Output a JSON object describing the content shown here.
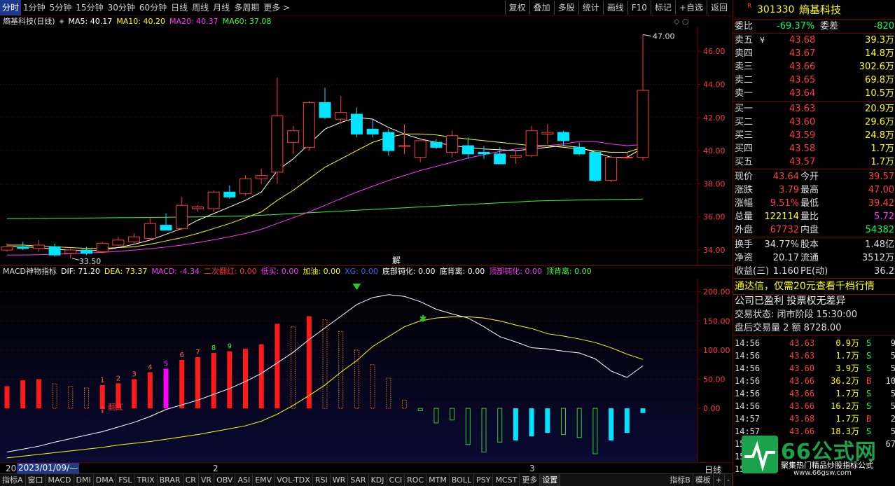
{
  "toolbar": {
    "periods": [
      "分时",
      "1分钟",
      "5分钟",
      "15分钟",
      "30分钟",
      "60分钟",
      "日线",
      "周线",
      "月线",
      "多周期",
      "更多 >"
    ],
    "active_period": "分时",
    "right_buttons": [
      "复权",
      "叠加",
      "多股",
      "统计",
      "画线",
      "F10",
      "标记",
      "+自选",
      "返回"
    ]
  },
  "chart_header": {
    "name": "熵基科技(日线)",
    "ma5": "MA5: 40.17",
    "ma10": "MA10: 40.20",
    "ma20": "MA20: 40.37",
    "ma60": "MA60: 37.08",
    "high_marker": "47.00",
    "low_marker": "33.50",
    "jie_label": "解"
  },
  "macd_header": {
    "name": "MACD神物指标",
    "items": [
      {
        "label": "DIF: 71.20",
        "color": "#ffffff"
      },
      {
        "label": "DEA: 73.37",
        "color": "#ffff00"
      },
      {
        "label": "MACD: -4.34",
        "color": "#ff33ff"
      },
      {
        "label": "二次翻红: 0.00",
        "color": "#ff3333"
      },
      {
        "label": "低买: 0.00",
        "color": "#ff33ff"
      },
      {
        "label": "加油: 0.00",
        "color": "#ffff00"
      },
      {
        "label": "XG: 0.00",
        "color": "#3366ff"
      },
      {
        "label": "底部钝化: 0.00",
        "color": "#ffffff"
      },
      {
        "label": "底背离: 0.00",
        "color": "#ffffff"
      },
      {
        "label": "顶部钝化: 0.00",
        "color": "#ff33ff"
      },
      {
        "label": "顶背离: 0.00",
        "color": "#33ff33"
      }
    ],
    "fanhong": "翻红"
  },
  "chart_data": [
    {
      "type": "candlestick",
      "title": "熵基科技(日线)",
      "ylim": [
        33.2,
        47.4
      ],
      "yticks": [
        34.0,
        36.0,
        38.0,
        40.0,
        42.0,
        44.0,
        46.0
      ],
      "colors": {
        "up": "#ff3b3b",
        "down": "#00e5ff",
        "ma5": "#ffffff",
        "ma10": "#ffff00",
        "ma20": "#ff33ff",
        "ma60": "#33ff33"
      },
      "candles": [
        {
          "o": 34.0,
          "h": 34.4,
          "l": 33.9,
          "c": 34.2
        },
        {
          "o": 34.2,
          "h": 34.5,
          "l": 34.0,
          "c": 34.1
        },
        {
          "o": 34.1,
          "h": 34.6,
          "l": 33.9,
          "c": 34.3
        },
        {
          "o": 34.2,
          "h": 34.4,
          "l": 33.6,
          "c": 33.7
        },
        {
          "o": 33.8,
          "h": 34.1,
          "l": 33.5,
          "c": 34.0
        },
        {
          "o": 34.0,
          "h": 34.2,
          "l": 33.7,
          "c": 33.8
        },
        {
          "o": 33.9,
          "h": 34.5,
          "l": 33.8,
          "c": 34.4
        },
        {
          "o": 34.3,
          "h": 34.8,
          "l": 34.2,
          "c": 34.6
        },
        {
          "o": 34.5,
          "h": 35.0,
          "l": 34.4,
          "c": 34.8
        },
        {
          "o": 34.7,
          "h": 36.0,
          "l": 34.6,
          "c": 35.6
        },
        {
          "o": 35.5,
          "h": 36.2,
          "l": 35.2,
          "c": 35.2
        },
        {
          "o": 35.3,
          "h": 37.2,
          "l": 35.2,
          "c": 36.7
        },
        {
          "o": 36.5,
          "h": 36.7,
          "l": 36.3,
          "c": 36.6
        },
        {
          "o": 36.5,
          "h": 37.6,
          "l": 36.3,
          "c": 37.5
        },
        {
          "o": 37.5,
          "h": 37.9,
          "l": 37.1,
          "c": 37.2
        },
        {
          "o": 37.4,
          "h": 38.5,
          "l": 37.3,
          "c": 38.3
        },
        {
          "o": 38.3,
          "h": 38.9,
          "l": 38.0,
          "c": 38.5
        },
        {
          "o": 38.7,
          "h": 44.4,
          "l": 38.0,
          "c": 42.1
        },
        {
          "o": 40.5,
          "h": 41.5,
          "l": 39.8,
          "c": 41.2
        },
        {
          "o": 40.2,
          "h": 43.0,
          "l": 40.0,
          "c": 42.9
        },
        {
          "o": 42.9,
          "h": 43.8,
          "l": 41.9,
          "c": 42.0
        },
        {
          "o": 41.9,
          "h": 43.3,
          "l": 41.6,
          "c": 42.3
        },
        {
          "o": 42.2,
          "h": 42.6,
          "l": 40.8,
          "c": 41.0
        },
        {
          "o": 41.3,
          "h": 41.9,
          "l": 40.8,
          "c": 41.0
        },
        {
          "o": 41.1,
          "h": 41.3,
          "l": 39.7,
          "c": 40.0
        },
        {
          "o": 40.3,
          "h": 41.6,
          "l": 39.8,
          "c": 40.3
        },
        {
          "o": 39.6,
          "h": 40.6,
          "l": 39.3,
          "c": 40.6
        },
        {
          "o": 40.5,
          "h": 40.7,
          "l": 40.1,
          "c": 40.2
        },
        {
          "o": 39.9,
          "h": 41.2,
          "l": 39.6,
          "c": 40.9
        },
        {
          "o": 40.3,
          "h": 40.8,
          "l": 39.5,
          "c": 39.8
        },
        {
          "o": 39.9,
          "h": 40.3,
          "l": 39.5,
          "c": 39.8
        },
        {
          "o": 39.8,
          "h": 40.2,
          "l": 39.2,
          "c": 39.2
        },
        {
          "o": 39.6,
          "h": 40.0,
          "l": 39.2,
          "c": 39.7
        },
        {
          "o": 39.7,
          "h": 41.5,
          "l": 39.6,
          "c": 41.2
        },
        {
          "o": 41.0,
          "h": 41.6,
          "l": 40.4,
          "c": 41.1
        },
        {
          "o": 41.1,
          "h": 41.2,
          "l": 40.3,
          "c": 40.6
        },
        {
          "o": 40.2,
          "h": 40.5,
          "l": 39.7,
          "c": 39.8
        },
        {
          "o": 39.9,
          "h": 40.0,
          "l": 38.1,
          "c": 38.2
        },
        {
          "o": 38.2,
          "h": 39.7,
          "l": 38.1,
          "c": 39.6
        },
        {
          "o": 39.6,
          "h": 39.9,
          "l": 39.5,
          "c": 39.6
        },
        {
          "o": 39.6,
          "h": 47.0,
          "l": 39.4,
          "c": 43.64
        }
      ],
      "ma5": [
        34.2,
        34.2,
        34.15,
        34.05,
        34.0,
        33.95,
        34.0,
        34.15,
        34.35,
        34.6,
        34.95,
        35.3,
        35.8,
        36.2,
        36.6,
        37.0,
        37.5,
        38.8,
        39.5,
        40.4,
        41.3,
        41.7,
        42.0,
        41.9,
        41.4,
        41.0,
        40.7,
        40.5,
        40.3,
        40.2,
        40.1,
        40.05,
        40.0,
        40.1,
        40.2,
        40.3,
        40.2,
        39.9,
        39.6,
        39.6,
        40.17
      ],
      "ma10": [
        34.3,
        34.3,
        34.25,
        34.2,
        34.15,
        34.1,
        34.1,
        34.15,
        34.2,
        34.35,
        34.55,
        34.75,
        35.0,
        35.3,
        35.6,
        35.95,
        36.3,
        37.0,
        37.6,
        38.3,
        39.0,
        39.5,
        40.0,
        40.5,
        40.8,
        41.0,
        41.0,
        40.95,
        40.8,
        40.7,
        40.6,
        40.5,
        40.4,
        40.3,
        40.3,
        40.2,
        40.1,
        40.0,
        39.9,
        39.9,
        40.2
      ],
      "ma20": [
        33.7,
        33.7,
        33.72,
        33.75,
        33.78,
        33.82,
        33.86,
        33.92,
        34.0,
        34.08,
        34.18,
        34.3,
        34.45,
        34.62,
        34.8,
        35.0,
        35.25,
        35.6,
        35.95,
        36.3,
        36.7,
        37.1,
        37.5,
        37.85,
        38.2,
        38.5,
        38.8,
        39.05,
        39.3,
        39.55,
        39.75,
        39.95,
        40.1,
        40.2,
        40.3,
        40.4,
        40.55,
        40.55,
        40.4,
        40.3,
        40.37
      ],
      "ma60": [
        35.9,
        35.9,
        35.91,
        35.92,
        35.92,
        35.93,
        35.94,
        35.95,
        35.96,
        35.97,
        35.98,
        35.99,
        36.0,
        36.02,
        36.04,
        36.06,
        36.1,
        36.15,
        36.2,
        36.25,
        36.3,
        36.35,
        36.4,
        36.45,
        36.5,
        36.55,
        36.6,
        36.65,
        36.7,
        36.75,
        36.8,
        36.85,
        36.9,
        36.95,
        36.98,
        37.0,
        37.02,
        37.03,
        37.05,
        37.06,
        37.08
      ]
    },
    {
      "type": "bar",
      "title": "MACD神物指标",
      "ylim": [
        -90,
        220
      ],
      "yticks": [
        0.0,
        50.0,
        100.0,
        150.0,
        200.0
      ],
      "colors": {
        "red": "#ff1a1a",
        "magenta": "#ff00ff",
        "cyan": "#00e5ff",
        "green": "#33cc33",
        "orange": "#e07010",
        "dif": "#ffffff",
        "dea": "#ffff00"
      },
      "bars": [
        {
          "v": 38,
          "c": "red",
          "f": "solid"
        },
        {
          "v": 48,
          "c": "red",
          "f": "solid"
        },
        {
          "v": 50,
          "c": "red",
          "f": "solid"
        },
        {
          "v": 42,
          "c": "orange",
          "f": "hollow"
        },
        {
          "v": 38,
          "c": "orange",
          "f": "hollow"
        },
        {
          "v": 35,
          "c": "orange",
          "f": "hollow"
        },
        {
          "v": 40,
          "c": "red",
          "f": "solid",
          "label": "1"
        },
        {
          "v": 43,
          "c": "red",
          "f": "solid",
          "label": "2"
        },
        {
          "v": 50,
          "c": "red",
          "f": "solid",
          "label": "3"
        },
        {
          "v": 62,
          "c": "red",
          "f": "solid",
          "label": "4"
        },
        {
          "v": 68,
          "c": "magenta",
          "f": "solid",
          "label": "5"
        },
        {
          "v": 83,
          "c": "red",
          "f": "solid",
          "label": "6"
        },
        {
          "v": 88,
          "c": "red",
          "f": "solid",
          "label": "7"
        },
        {
          "v": 95,
          "c": "red",
          "f": "solid",
          "label": "8"
        },
        {
          "v": 98,
          "c": "red",
          "f": "solid",
          "label": "9"
        },
        {
          "v": 102,
          "c": "red",
          "f": "solid"
        },
        {
          "v": 110,
          "c": "red",
          "f": "solid"
        },
        {
          "v": 145,
          "c": "red",
          "f": "solid"
        },
        {
          "v": 140,
          "c": "orange",
          "f": "hollow"
        },
        {
          "v": 158,
          "c": "red",
          "f": "solid"
        },
        {
          "v": 152,
          "c": "orange",
          "f": "hollow"
        },
        {
          "v": 132,
          "c": "orange",
          "f": "hollow"
        },
        {
          "v": 100,
          "c": "orange",
          "f": "hollow"
        },
        {
          "v": 75,
          "c": "orange",
          "f": "hollow"
        },
        {
          "v": 52,
          "c": "orange",
          "f": "hollow"
        },
        {
          "v": 14,
          "c": "orange",
          "f": "hollow"
        },
        {
          "v": -4,
          "c": "green",
          "f": "hollow"
        },
        {
          "v": -25,
          "c": "green",
          "f": "hollow"
        },
        {
          "v": -20,
          "c": "green",
          "f": "hollow"
        },
        {
          "v": -62,
          "c": "green",
          "f": "hollow"
        },
        {
          "v": -75,
          "c": "green",
          "f": "hollow"
        },
        {
          "v": -58,
          "c": "green",
          "f": "hollow"
        },
        {
          "v": -55,
          "c": "cyan",
          "f": "solid"
        },
        {
          "v": -48,
          "c": "cyan",
          "f": "solid"
        },
        {
          "v": -42,
          "c": "cyan",
          "f": "solid"
        },
        {
          "v": -45,
          "c": "green",
          "f": "hollow"
        },
        {
          "v": -50,
          "c": "green",
          "f": "hollow"
        },
        {
          "v": -78,
          "c": "green",
          "f": "hollow"
        },
        {
          "v": -55,
          "c": "cyan",
          "f": "solid"
        },
        {
          "v": -42,
          "c": "cyan",
          "f": "solid"
        },
        {
          "v": -8,
          "c": "cyan",
          "f": "solid"
        }
      ],
      "dif": [
        -75,
        -70,
        -65,
        -58,
        -52,
        -46,
        -40,
        -32,
        -24,
        -14,
        -2,
        6,
        14,
        24,
        34,
        46,
        60,
        78,
        96,
        118,
        138,
        158,
        178,
        190,
        195,
        192,
        183,
        170,
        162,
        155,
        140,
        123,
        114,
        104,
        102,
        98,
        95,
        85,
        64,
        53,
        73
      ],
      "dea": [
        -85,
        -82,
        -79,
        -76,
        -73,
        -70,
        -67,
        -63,
        -60,
        -57,
        -53,
        -49,
        -45,
        -40,
        -35,
        -30,
        -22,
        -10,
        5,
        22,
        40,
        62,
        82,
        106,
        123,
        140,
        150,
        155,
        157,
        157,
        155,
        150,
        143,
        137,
        128,
        124,
        119,
        113,
        104,
        93,
        84,
        78,
        73
      ],
      "dif_peak_marker": "green-down-triangle",
      "cross_marker": "green-star"
    }
  ],
  "date_bar": {
    "num_left": "20",
    "date": "2023/01/09/—",
    "num_mid": "2",
    "num_right": "3",
    "period": "日线"
  },
  "tabs": [
    "指标A",
    "窗口",
    "MACD",
    "DMI",
    "DMA",
    "FSL",
    "TRIX",
    "BRAR",
    "CR",
    "VR",
    "OBV",
    "ASI",
    "EMV",
    "VOL-TDX",
    "RSI",
    "WR",
    "SAR",
    "KDJ",
    "CCI",
    "ROC",
    "MTM",
    "BOLL",
    "PSY",
    "MCST",
    "更多",
    "设置"
  ],
  "tabs_active": "设置",
  "tabs_right": [
    "指标B",
    "模板",
    "+",
    "-"
  ],
  "quote": {
    "code": "301330",
    "name": "熵基科技",
    "r_mark": "R",
    "webi_label": "委比",
    "webi_value": "-69.37%",
    "weicha_label": "委差",
    "weicha_value": "-820",
    "asks": [
      {
        "label": "卖五",
        "price": "43.68",
        "vol": "39.3万"
      },
      {
        "label": "卖四",
        "price": "43.67",
        "vol": "14.8万"
      },
      {
        "label": "卖三",
        "price": "43.66",
        "vol": "302.6万"
      },
      {
        "label": "卖二",
        "price": "43.65",
        "vol": "69.8万"
      },
      {
        "label": "卖一",
        "price": "43.64",
        "vol": "10.5万"
      }
    ],
    "bids": [
      {
        "label": "买一",
        "price": "43.63",
        "vol": "20.9万"
      },
      {
        "label": "买二",
        "price": "43.60",
        "vol": "29.6万"
      },
      {
        "label": "买三",
        "price": "43.59",
        "vol": "24.8万"
      },
      {
        "label": "买四",
        "price": "43.58",
        "vol": "1.7万"
      },
      {
        "label": "买五",
        "price": "43.57",
        "vol": "1.7万"
      }
    ],
    "ask5_suffix": "¥",
    "stats": [
      {
        "l1": "现价",
        "v1": "43.64",
        "c1": "#ff3b3b",
        "l2": "今开",
        "v2": "39.57",
        "c2": "#ff3b3b"
      },
      {
        "l1": "涨跌",
        "v1": "3.79",
        "c1": "#ff3b3b",
        "l2": "最高",
        "v2": "47.00",
        "c2": "#ff3b3b"
      },
      {
        "l1": "涨幅",
        "v1": "9.51%",
        "c1": "#ff3b3b",
        "l2": "最低",
        "v2": "39.42",
        "c2": "#ff3b3b"
      },
      {
        "l1": "总量",
        "v1": "122114",
        "c1": "#ffff00",
        "l2": "量比",
        "v2": "5.72",
        "c2": "#ff33ff"
      },
      {
        "l1": "外盘",
        "v1": "67732",
        "c1": "#ff3b3b",
        "l2": "内盘",
        "v2": "54382",
        "c2": "#00ff66"
      }
    ],
    "stats2": [
      {
        "l1": "换手",
        "v1": "34.77%",
        "l2": "股本",
        "v2": "1.48亿"
      },
      {
        "l1": "净资",
        "v1": "20.17",
        "l2": "流通",
        "v2": "3512万"
      },
      {
        "l1": "收益(三)",
        "v1": "1.160",
        "l2": "PE(动)",
        "v2": "36.2"
      }
    ],
    "promo": "通达信，仅需20元查看千档行情",
    "company_note": "公司已盈利 投票权无差异",
    "trade_status": "交易状态: 闭市阶段 15:30:00",
    "after_hours": "盘后交易量 2 额 8728.00",
    "ticks": [
      {
        "t": "14:56",
        "p": "43.63",
        "v": "0.9万",
        "s": "S",
        "n": "9"
      },
      {
        "t": "14:56",
        "p": "43.63",
        "v": "1.7万",
        "s": "S",
        "n": "5"
      },
      {
        "t": "14:56",
        "p": "43.60",
        "v": "3.9万",
        "s": "S",
        "n": "5"
      },
      {
        "t": "14:56",
        "p": "43.66",
        "v": "36.2万",
        "s": "B",
        "n": "10"
      },
      {
        "t": "14:56",
        "p": "43.66",
        "v": "1.7万",
        "s": "S",
        "n": "5"
      },
      {
        "t": "14:56",
        "p": "43.66",
        "v": "16.2万",
        "s": "S",
        "n": "5"
      },
      {
        "t": "14:57",
        "p": "43.68",
        "v": "1.7万",
        "s": "B",
        "n": "2"
      },
      {
        "t": "14:57",
        "p": "43.66",
        "v": "18.3万",
        "s": "S",
        "n": "5"
      },
      {
        "t": "15",
        "p": "",
        "v": "",
        "s": "",
        "n": "67"
      },
      {
        "t": "15",
        "p": "",
        "v": "",
        "s": "",
        "n": ""
      },
      {
        "t": "15",
        "p": "",
        "v": "",
        "s": "",
        "n": ""
      }
    ]
  },
  "watermark": {
    "brand": "66公式网",
    "slogan": "聚集热门精品炒股指标公式",
    "url": "www.66gsw.com"
  }
}
